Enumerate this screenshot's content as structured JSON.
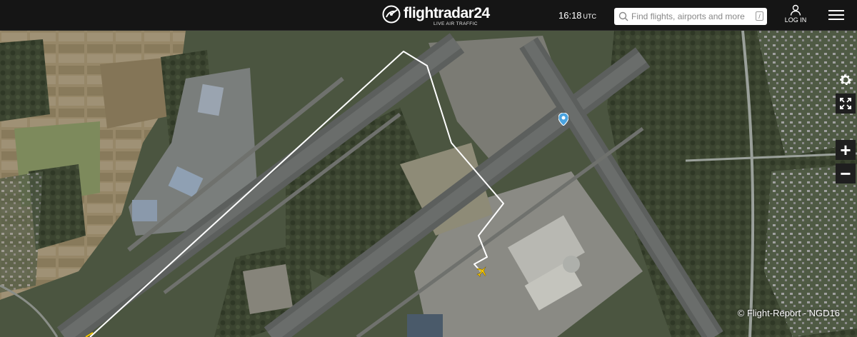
{
  "header": {
    "logo_text": "flightradar24",
    "logo_tagline": "LIVE AIR TRAFFIC",
    "time": "16:18",
    "timezone": "UTC",
    "search_placeholder": "Find flights, airports and more",
    "search_shortcut": "/",
    "login_label": "LOG IN"
  },
  "map": {
    "credit": "© Flight-Report - NGD16",
    "controls": {
      "zoom_in_label": "+",
      "zoom_out_label": "−"
    }
  },
  "icons": [
    "logo-radar-icon",
    "search-icon",
    "user-icon",
    "hamburger-menu-icon",
    "settings-gear-icon",
    "fullscreen-icon",
    "aircraft-icon",
    "location-pin-icon"
  ],
  "colors": {
    "header_bg": "#151515",
    "flight_path": "#ffffff",
    "aircraft": "#f2c500",
    "pin": "#4aa3df"
  }
}
